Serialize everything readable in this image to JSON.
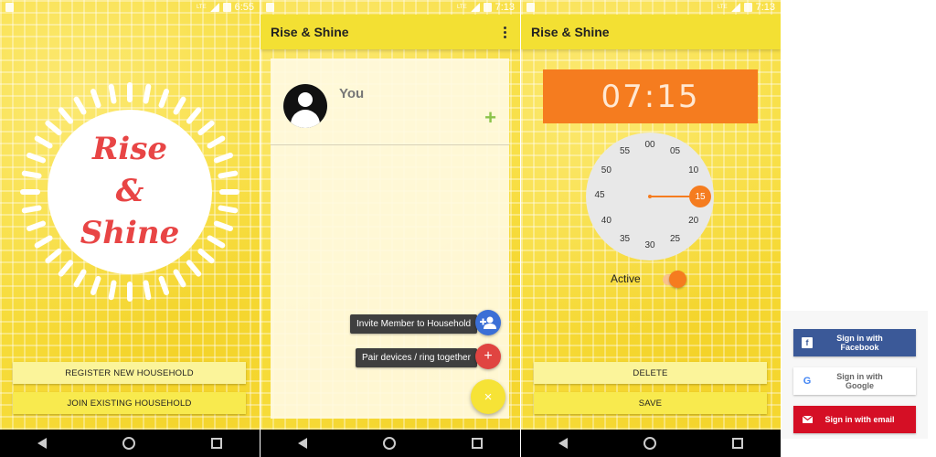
{
  "screens": [
    {
      "status_time": "6:55",
      "logo_lines": [
        "Rise",
        "&",
        "Shine"
      ],
      "buttons": [
        "REGISTER NEW HOUSEHOLD",
        "JOIN EXISTING HOUSEHOLD"
      ]
    },
    {
      "status_time": "7:13",
      "title": "Rise & Shine",
      "member_name": "You",
      "add_symbol": "+",
      "fab_menu": [
        {
          "label": "Invite Member to Household",
          "icon": "add-person-icon",
          "color": "#3b6fd6"
        },
        {
          "label": "Pair devices / ring together",
          "icon": "plus-icon",
          "color": "#e04441"
        }
      ],
      "fab_main_symbol": "×"
    },
    {
      "status_time": "7:13",
      "title": "Rise & Shine",
      "time": "07:15",
      "dial_numbers": [
        "00",
        "05",
        "10",
        "15",
        "20",
        "25",
        "30",
        "35",
        "40",
        "45",
        "50",
        "55"
      ],
      "selected_minute": "15",
      "active_label": "Active",
      "active": true,
      "buttons": [
        "DELETE",
        "SAVE"
      ]
    }
  ],
  "signin": {
    "facebook": {
      "label": "Sign in with Facebook",
      "color": "#3b5998"
    },
    "google": {
      "label": "Sign in with Google"
    },
    "email": {
      "label": "Sign in with email",
      "color": "#d50f25"
    }
  },
  "colors": {
    "accent_yellow": "#f3e033",
    "accent_orange": "#f57c1f",
    "logo_red": "#e84545"
  }
}
